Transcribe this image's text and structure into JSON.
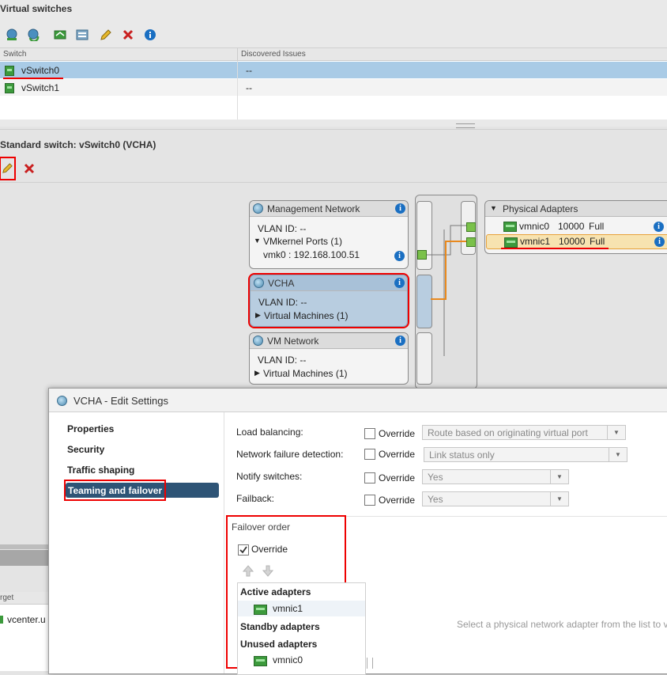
{
  "vswitches": {
    "title": "Virtual switches",
    "columns": {
      "switch": "Switch",
      "issues": "Discovered Issues"
    },
    "rows": [
      {
        "name": "vSwitch0",
        "issues": "--"
      },
      {
        "name": "vSwitch1",
        "issues": "--"
      }
    ]
  },
  "standard_switch": {
    "title": "Standard switch: vSwitch0 (VCHA)"
  },
  "topology": {
    "mgmt": {
      "title": "Management Network",
      "vlan": "VLAN ID: --",
      "ports": "VMkernel Ports (1)",
      "vmk": "vmk0 : 192.168.100.51"
    },
    "vcha": {
      "title": "VCHA",
      "vlan": "VLAN ID: --",
      "vms": "Virtual Machines (1)"
    },
    "vmnet": {
      "title": "VM Network",
      "vlan": "VLAN ID: --",
      "vms": "Virtual Machines (1)"
    },
    "physical": {
      "title": "Physical Adapters",
      "adapters": [
        {
          "name": "vmnic0",
          "speed": "10000",
          "duplex": "Full"
        },
        {
          "name": "vmnic1",
          "speed": "10000",
          "duplex": "Full"
        }
      ]
    },
    "info_glyph": "i"
  },
  "background_grid": {
    "col_label": "rget",
    "row_value": "vcenter.u"
  },
  "dialog": {
    "title": "VCHA - Edit Settings",
    "nav": [
      "Properties",
      "Security",
      "Traffic shaping",
      "Teaming and failover"
    ],
    "override_label": "Override",
    "settings": [
      {
        "label": "Load balancing:",
        "value": "Route based on originating virtual port"
      },
      {
        "label": "Network failure detection:",
        "value": "Link status only"
      },
      {
        "label": "Notify switches:",
        "value": "Yes"
      },
      {
        "label": "Failback:",
        "value": "Yes"
      }
    ],
    "failover": {
      "title": "Failover order",
      "override_label": "Override",
      "groups": {
        "active": "Active adapters",
        "active_item": "vmnic1",
        "standby": "Standby adapters",
        "unused": "Unused adapters",
        "unused_item": "vmnic0"
      }
    },
    "hint": "Select a physical network adapter from the list to v"
  },
  "colors": {
    "accent_line": "#e8891e",
    "highlight": "#e00000",
    "selected_row": "#a9cbe6",
    "nav_selected": "#2e5476"
  },
  "icons": [
    "add-network-icon",
    "refresh-icon",
    "migrate-icon",
    "manage-icon",
    "edit-pencil-icon",
    "delete-x-icon",
    "info-icon",
    "globe-icon",
    "nic-icon",
    "chevron-down-icon",
    "chevron-right-icon",
    "checkbox-checked-icon",
    "arrow-up-icon",
    "arrow-down-icon"
  ]
}
